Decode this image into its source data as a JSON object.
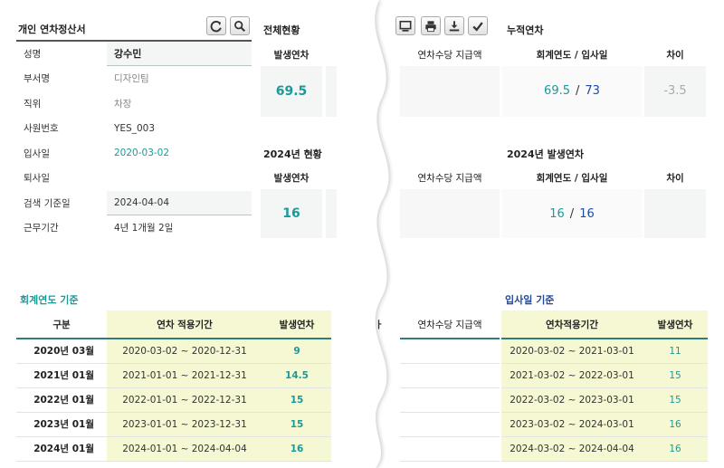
{
  "panel": {
    "title": "개인 연차정산서",
    "rows": [
      {
        "label": "성명",
        "value": "강수민"
      },
      {
        "label": "부서명",
        "value": "디자인팀"
      },
      {
        "label": "직위",
        "value": "차장"
      },
      {
        "label": "사원번호",
        "value": "YES_003"
      },
      {
        "label": "입사일",
        "value": "2020-03-02"
      },
      {
        "label": "퇴사일",
        "value": ""
      },
      {
        "label": "검색 기준일",
        "value": "2024-04-04"
      },
      {
        "label": "근무기간",
        "value": "4년 1개월 2일"
      }
    ],
    "icons": [
      "refresh-icon",
      "search-icon",
      "monitor-icon",
      "print-icon",
      "download-icon",
      "check-icon"
    ]
  },
  "overall": {
    "title": "전체현황",
    "col_issued": "발생연차",
    "col_allowance": "연차수당 지급액",
    "issued": "69.5"
  },
  "cumulative": {
    "title": "누적연차",
    "col_ratio": "회계연도 / 입사일",
    "col_diff": "차이",
    "fiscal": "69.5",
    "hire": "73",
    "diff": "-3.5"
  },
  "year_status": {
    "title": "2024년 현황",
    "col_issued": "발생연차",
    "col_allowance": "연차수당 지급액",
    "issued": "16"
  },
  "year_issued": {
    "title": "2024년 발생연차",
    "col_ratio": "회계연도 / 입사일",
    "col_diff": "차이",
    "fiscal": "16",
    "hire": "16",
    "diff": ""
  },
  "fiscal_basis": {
    "title": "회계연도 기준",
    "headers": {
      "period": "구분",
      "range": "연차 적용기간",
      "count": "발생연차",
      "allowance": "연차수당 지급액",
      "cut": "ㅏ"
    },
    "rows": [
      {
        "period": "2020년 03월",
        "range": "2020-03-02 ~ 2020-12-31",
        "count": "9"
      },
      {
        "period": "2021년 01월",
        "range": "2021-01-01 ~ 2021-12-31",
        "count": "14.5"
      },
      {
        "period": "2022년 01월",
        "range": "2022-01-01 ~ 2022-12-31",
        "count": "15"
      },
      {
        "period": "2023년 01월",
        "range": "2023-01-01 ~ 2023-12-31",
        "count": "15"
      },
      {
        "period": "2024년 01월",
        "range": "2024-01-01 ~ 2024-04-04",
        "count": "16"
      }
    ]
  },
  "hire_basis": {
    "title": "입사일 기준",
    "headers": {
      "range": "연차적용기간",
      "count": "발생연차"
    },
    "rows": [
      {
        "range": "2020-03-02 ~ 2021-03-01",
        "count": "11"
      },
      {
        "range": "2021-03-02 ~ 2022-03-01",
        "count": "15"
      },
      {
        "range": "2022-03-02 ~ 2023-03-01",
        "count": "15"
      },
      {
        "range": "2023-03-02 ~ 2024-03-01",
        "count": "16"
      },
      {
        "range": "2024-03-02 ~ 2024-04-04",
        "count": "16"
      }
    ]
  },
  "colors": {
    "teal": "#1a9a9a",
    "navy": "#1f4aa0",
    "green_line": "#2d7d7d",
    "yellow": "#f5f8d2"
  }
}
